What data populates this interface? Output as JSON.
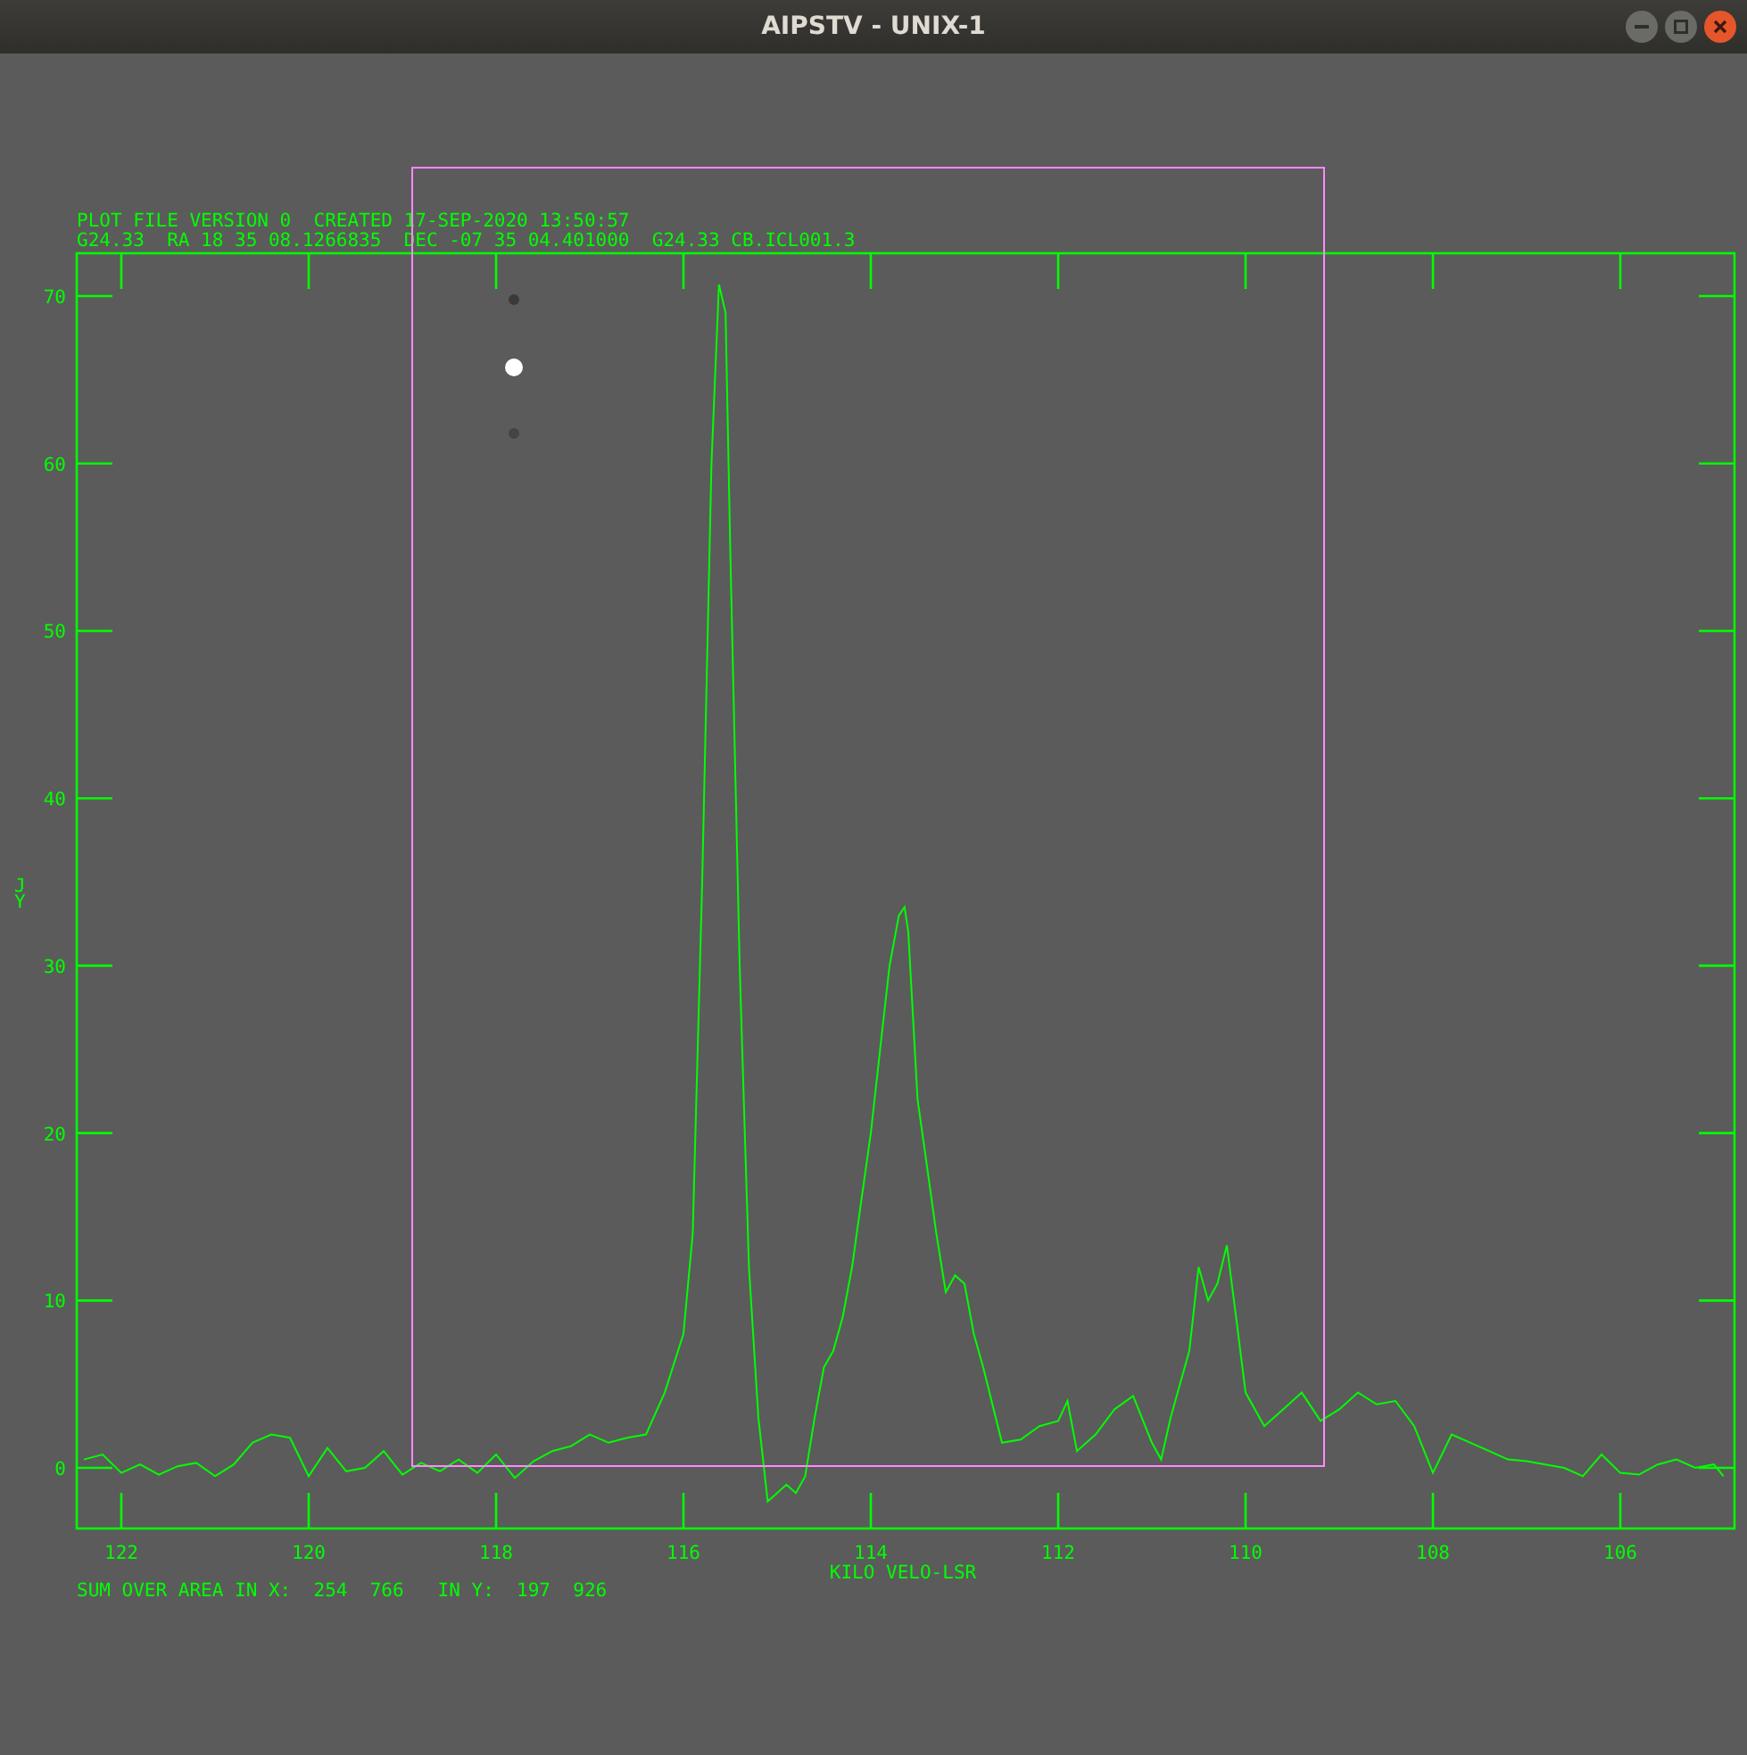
{
  "window": {
    "title": "AIPSTV - UNIX-1"
  },
  "plot": {
    "header_lines": [
      "PLOT FILE VERSION 0  CREATED 17-SEP-2020 13:50:57",
      "G24.33  RA 18 35 08.1266835  DEC -07 35 04.401000  G24.33 CB.ICL001.3"
    ],
    "chart_data": {
      "type": "line",
      "xlabel": "KILO VELO-LSR",
      "ylabel": "JY",
      "xlim": [
        122.476,
        104.781
      ],
      "ylim": [
        -3.62,
        72.56
      ],
      "xticks": [
        122,
        120,
        118,
        116,
        114,
        112,
        110,
        108,
        106
      ],
      "yticks": [
        0,
        10,
        20,
        30,
        40,
        50,
        60,
        70
      ],
      "x": [
        122.4,
        122.2,
        122.0,
        121.8,
        121.6,
        121.4,
        121.2,
        121.0,
        120.8,
        120.6,
        120.4,
        120.2,
        120.0,
        119.8,
        119.6,
        119.4,
        119.2,
        119.0,
        118.8,
        118.6,
        118.4,
        118.2,
        118.0,
        117.8,
        117.6,
        117.4,
        117.2,
        117.0,
        116.8,
        116.6,
        116.4,
        116.2,
        116.0,
        115.9,
        115.8,
        115.7,
        115.62,
        115.55,
        115.5,
        115.4,
        115.3,
        115.2,
        115.1,
        115.0,
        114.9,
        114.8,
        114.7,
        114.6,
        114.5,
        114.4,
        114.3,
        114.2,
        114.1,
        114.0,
        113.9,
        113.8,
        113.7,
        113.64,
        113.6,
        113.5,
        113.4,
        113.3,
        113.2,
        113.1,
        113.0,
        112.9,
        112.8,
        112.6,
        112.4,
        112.2,
        112.0,
        111.9,
        111.8,
        111.6,
        111.4,
        111.2,
        111.0,
        110.9,
        110.8,
        110.6,
        110.5,
        110.4,
        110.3,
        110.2,
        110.1,
        110.0,
        109.8,
        109.6,
        109.4,
        109.2,
        109.0,
        108.8,
        108.6,
        108.4,
        108.2,
        108.0,
        107.8,
        107.6,
        107.4,
        107.2,
        107.0,
        106.8,
        106.6,
        106.4,
        106.2,
        106.0,
        105.8,
        105.6,
        105.4,
        105.2,
        105.0,
        104.9
      ],
      "series": [
        {
          "color": "#00ff00",
          "values": [
            0.5,
            0.8,
            -0.3,
            0.2,
            -0.4,
            0.1,
            0.3,
            -0.5,
            0.2,
            1.5,
            2.0,
            1.8,
            -0.5,
            1.2,
            -0.2,
            0.0,
            1.0,
            -0.4,
            0.3,
            -0.2,
            0.5,
            -0.3,
            0.8,
            -0.6,
            0.4,
            1.0,
            1.3,
            2.0,
            1.5,
            1.8,
            2.0,
            4.5,
            8,
            14,
            35,
            60,
            70.7,
            69,
            55,
            30,
            12,
            3,
            -2,
            -1.5,
            -1,
            -1.5,
            -0.5,
            3,
            6,
            7,
            9,
            12,
            16,
            20,
            25,
            30,
            33,
            33.5,
            32,
            22,
            18,
            14,
            10.5,
            11.5,
            11,
            8,
            6,
            1.5,
            1.7,
            2.5,
            2.8,
            4,
            1,
            2,
            3.5,
            4.3,
            1.5,
            0.5,
            3,
            7,
            12,
            10,
            11,
            13.3,
            9,
            4.5,
            2.5,
            3.5,
            4.5,
            2.8,
            3.5,
            4.5,
            3.8,
            4,
            2.5,
            -0.3,
            2,
            1.5,
            1,
            0.5,
            0.4,
            0.2,
            0,
            -0.5,
            0.8,
            -0.3,
            -0.4,
            0.2,
            0.5,
            0,
            0.2,
            -0.5
          ]
        }
      ]
    },
    "footer": "SUM OVER AREA IN X:  254  766   IN Y:  197  926"
  }
}
